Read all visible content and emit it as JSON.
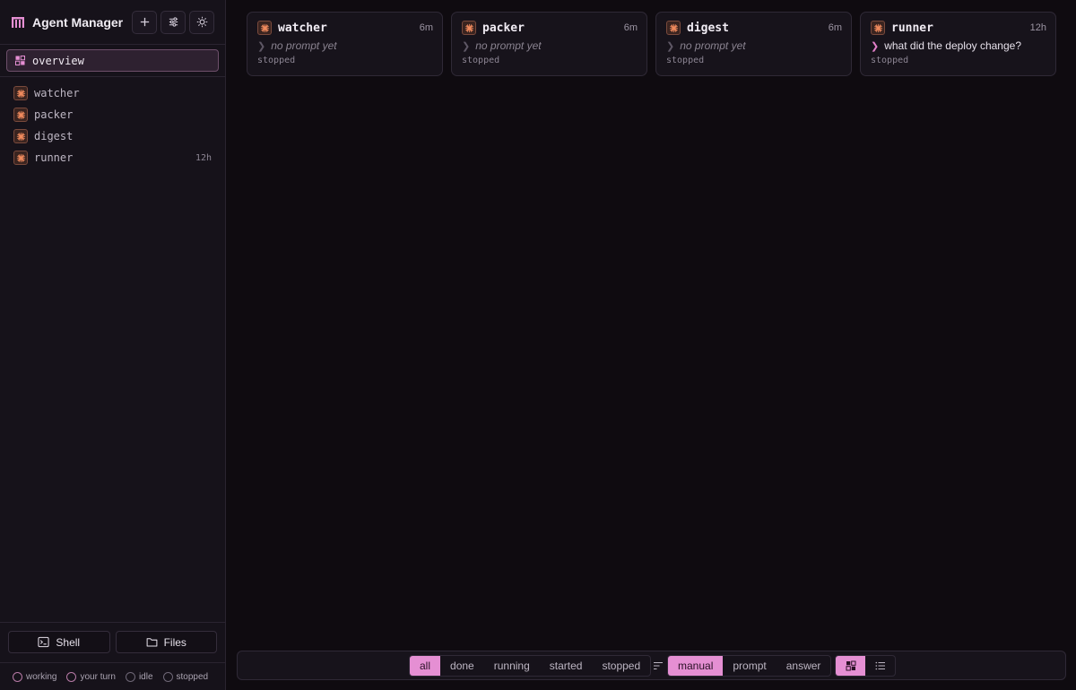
{
  "app": {
    "title": "Agent Manager"
  },
  "sidebar": {
    "overview_label": "overview",
    "agents": [
      {
        "name": "watcher",
        "age": ""
      },
      {
        "name": "packer",
        "age": ""
      },
      {
        "name": "digest",
        "age": ""
      },
      {
        "name": "runner",
        "age": "12h"
      }
    ],
    "shell_label": "Shell",
    "files_label": "Files",
    "legend": [
      "working",
      "your turn",
      "idle",
      "stopped"
    ]
  },
  "cards": [
    {
      "name": "watcher",
      "age": "6m",
      "prompt": "no prompt yet",
      "status": "stopped"
    },
    {
      "name": "packer",
      "age": "6m",
      "prompt": "no prompt yet",
      "status": "stopped"
    },
    {
      "name": "digest",
      "age": "6m",
      "prompt": "no prompt yet",
      "status": "stopped"
    },
    {
      "name": "runner",
      "age": "12h",
      "prompt": "what did the deploy change?",
      "status": "stopped"
    }
  ],
  "toolbar": {
    "filters": [
      "all",
      "done",
      "running",
      "started",
      "stopped"
    ],
    "active_filter": "all",
    "sorts": [
      "manual",
      "prompt",
      "answer"
    ],
    "active_sort": "manual"
  },
  "colors": {
    "accent": "#e58fd3",
    "agent_icon": "#f08a5d"
  }
}
